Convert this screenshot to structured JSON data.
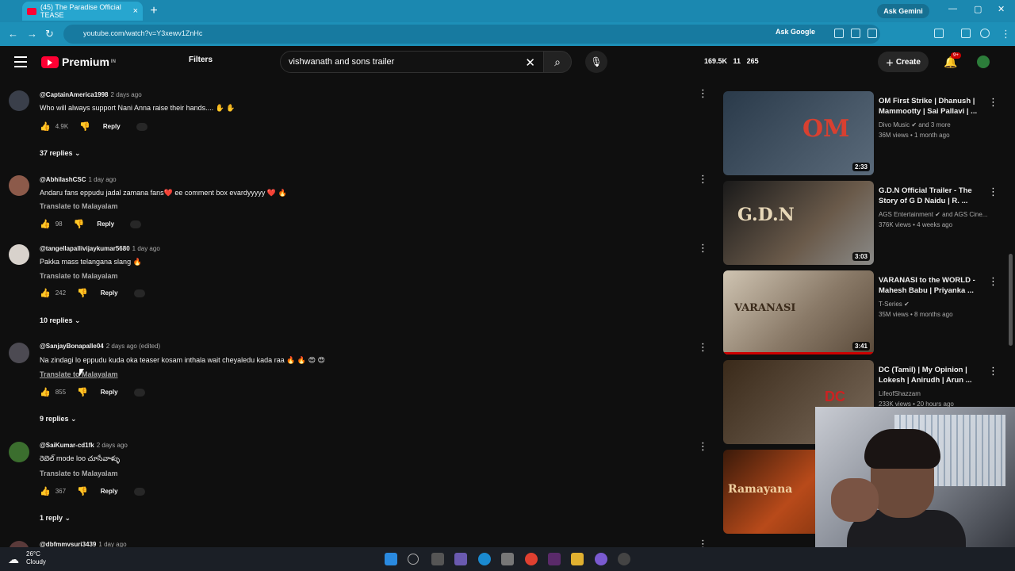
{
  "browser": {
    "tab_title": "(45) The Paradise Official TEASE",
    "new_tab": "+",
    "ask_gemini": "Ask Gemini",
    "url": "youtube.com/watch?v=Y3xewv1ZnHc",
    "ask_google": "Ask Google"
  },
  "youtube": {
    "logo": "Premium",
    "logo_sup": "IN",
    "filters": "Filters",
    "search_value": "vishwanath and sons trailer",
    "stats": {
      "views": "169.5K",
      "watching": "11",
      "likes": "265"
    },
    "create": "Create",
    "notifications": "9+"
  },
  "comments": [
    {
      "handle": "@CaptainAmerica1998",
      "time": "2 days ago",
      "text": "Who will always support Nani Anna raise their hands.... ✋ ✋",
      "translate": "",
      "likes": "4.9K",
      "reply": "Reply",
      "replies": "37 replies",
      "avatar_color": "#3a3f4a"
    },
    {
      "handle": "@AbhilashCSC",
      "time": "1 day ago",
      "text": "Andaru fans eppudu jadal zamana fans❤️ ee comment box evardyyyyy ❤️ 🔥",
      "translate": "Translate to Malayalam",
      "likes": "98",
      "reply": "Reply",
      "replies": "",
      "avatar_color": "#8c5a4a"
    },
    {
      "handle": "@tangellapallivijaykumar5680",
      "time": "1 day ago",
      "text": "Pakka mass telangana slang 🔥",
      "translate": "Translate to Malayalam",
      "likes": "242",
      "reply": "Reply",
      "replies": "10 replies",
      "avatar_color": "#d8d2cc"
    },
    {
      "handle": "@SanjayBonapalle04",
      "time": "2 days ago (edited)",
      "text": "Na zindagi lo eppudu kuda oka teaser kosam inthala wait cheyaledu kada raa 🔥 🔥 😍 😍",
      "translate": "Translate to Malayalam",
      "likes": "855",
      "reply": "Reply",
      "replies": "9 replies",
      "avatar_color": "#4c4a52"
    },
    {
      "handle": "@SaiKumar-cd1fk",
      "time": "2 days ago",
      "text": "రెబెల్ mode loo చూసేవాళ్ళు",
      "translate": "Translate to Malayalam",
      "likes": "367",
      "reply": "Reply",
      "replies": "1 reply",
      "avatar_color": "#3b6e2e"
    },
    {
      "handle": "@dbfmmvsuri3439",
      "time": "1 day ago",
      "text": "",
      "translate": "",
      "likes": "",
      "reply": "",
      "replies": "",
      "avatar_color": "#5a3a3a"
    }
  ],
  "recommendations": [
    {
      "title": "OM First Strike | Dhanush | Mammootty | Sai Pallavi | ...",
      "channel": "Divo Music ✔ and 3 more",
      "meta": "36M views • 1 month ago",
      "duration": "2:33",
      "thumb_text": "OM",
      "thumb_color": "#3a4a5a"
    },
    {
      "title": "G.D.N Official Trailer - The Story of G D Naidu | R. ...",
      "channel": "AGS Entertainment ✔ and AGS Cine...",
      "meta": "376K views • 4 weeks ago",
      "duration": "3:03",
      "thumb_text": "G.D.N",
      "thumb_color": "#4a4038"
    },
    {
      "title": "VARANASI to the WORLD - Mahesh Babu | Priyanka ...",
      "channel": "T-Series ✔",
      "meta": "35M views • 8 months ago",
      "duration": "3:41",
      "thumb_text": "VARANASI",
      "thumb_color": "#8a7a68"
    },
    {
      "title": "DC (Tamil) | My Opinion | Lokesh | Anirudh | Arun ...",
      "channel": "LifeofShazzam",
      "meta": "233K views • 20 hours ago",
      "duration": "",
      "thumb_text": "DC",
      "thumb_color": "#5a4a3a"
    },
    {
      "title": "",
      "channel": "",
      "meta": "",
      "duration": "",
      "thumb_text": "Ramayana",
      "thumb_color": "#8a3a1a"
    }
  ],
  "taskbar": {
    "temp": "26°C",
    "condition": "Cloudy"
  }
}
